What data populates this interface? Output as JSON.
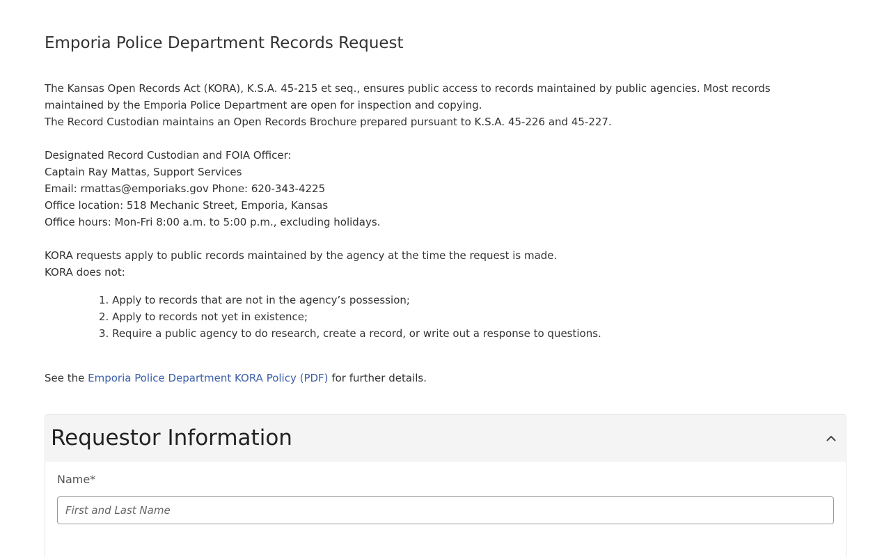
{
  "page": {
    "title": "Emporia Police Department Records Request"
  },
  "intro": {
    "kora_line1": "The Kansas Open Records Act (KORA), K.S.A. 45-215 et seq., ensures public access to records maintained by public agencies. Most records maintained by the Emporia Police Department are open for inspection and copying.",
    "kora_line2": "The Record Custodian maintains an Open Records Brochure prepared pursuant to K.S.A. 45-226 and 45-227.",
    "custodian_heading": "Designated Record Custodian and FOIA Officer:",
    "custodian_name": "Captain Ray Mattas, Support Services",
    "contact": "Email: rmattas@emporiaks.gov Phone: 620-343-4225",
    "office_location": "Office location: 518 Mechanic Street, Emporia, Kansas",
    "office_hours": "Office hours: Mon-Fri 8:00 a.m. to 5:00 p.m., excluding holidays.",
    "applies_line": "KORA requests apply to public records maintained by the agency at the time the request is made.",
    "does_not_line": "KORA does not:",
    "limits": [
      "1. Apply to records that are not in the agency’s possession;",
      "2. Apply to records not yet in existence;",
      "3. Require a public agency to do research, create a record, or write out a response to questions."
    ],
    "see_prefix": "See the ",
    "policy_link": "Emporia Police Department KORA Policy (PDF)",
    "see_suffix": " for further details."
  },
  "requestor": {
    "section_title": "Requestor Information",
    "collapse_icon": "chevron-up-icon",
    "name_label": "Name*",
    "name_value": "",
    "name_placeholder": "First and Last Name"
  },
  "colors": {
    "link": "#3b5fa8",
    "card_header_bg": "#f4f4f4",
    "text": "#333333"
  }
}
